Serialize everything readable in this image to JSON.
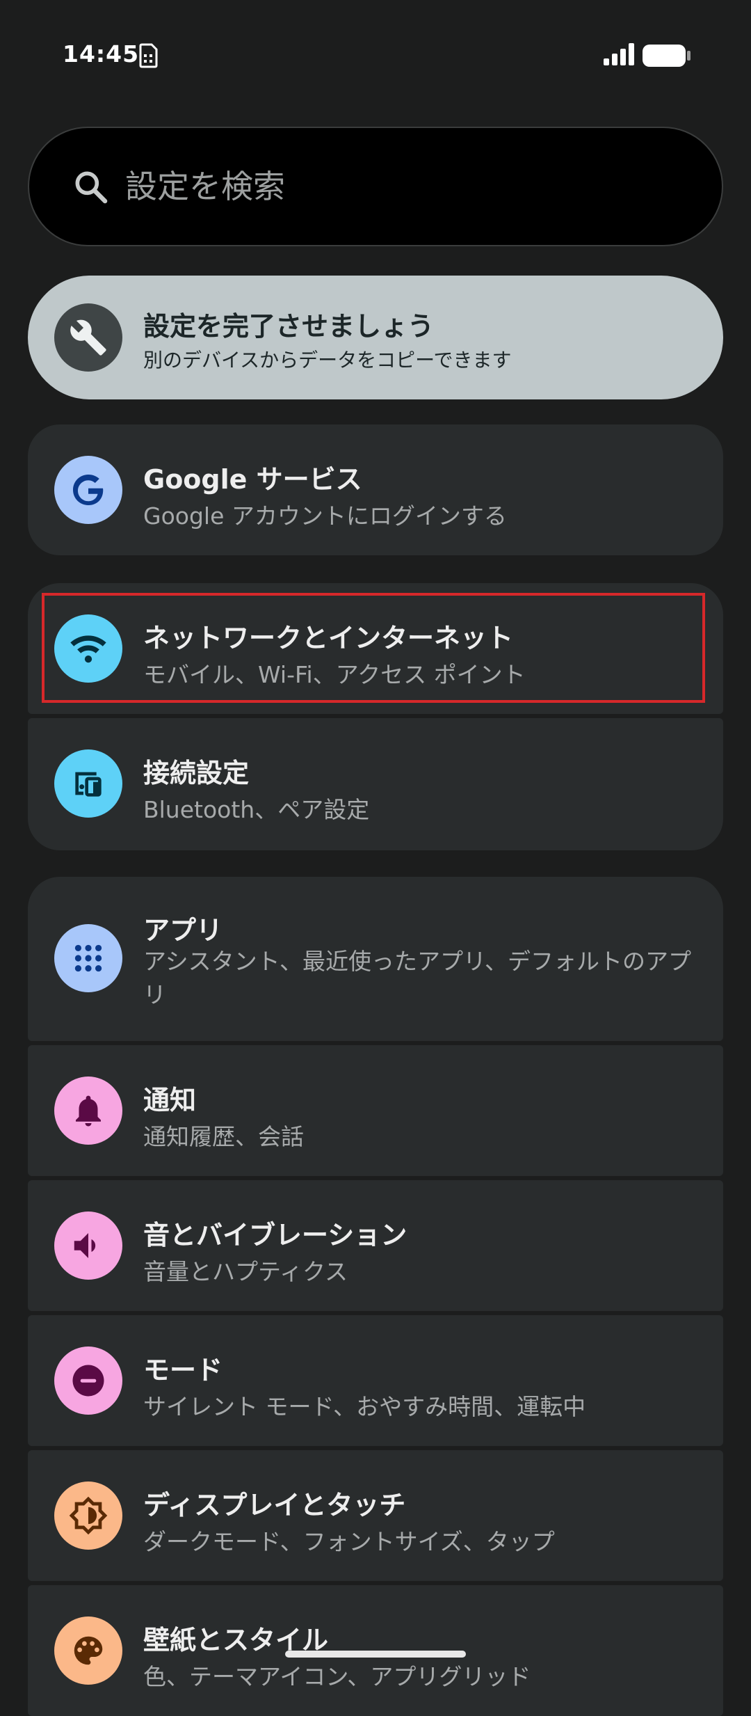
{
  "status": {
    "time": "14:45",
    "icons": [
      "sim-card-icon",
      "signal-icon",
      "battery-icon"
    ]
  },
  "search": {
    "placeholder": "設定を検索",
    "icon": "search-icon"
  },
  "setup": {
    "title": "設定を完了させましょう",
    "subtitle": "別のデバイスからデータをコピーできます",
    "icon": "wrench-icon"
  },
  "groups": [
    {
      "items": [
        {
          "title": "Google サービス",
          "subtitle": "Google アカウントにログインする",
          "icon": "google-icon",
          "color": "#a8c7fa"
        }
      ]
    },
    {
      "items": [
        {
          "title": "ネットワークとインターネット",
          "subtitle": "モバイル、Wi-Fi、アクセス ポイント",
          "icon": "wifi-icon",
          "color": "#5ed1f7"
        },
        {
          "title": "接続設定",
          "subtitle": "Bluetooth、ペア設定",
          "icon": "connected-devices-icon",
          "color": "#5ed1f7"
        }
      ]
    },
    {
      "items": [
        {
          "title": "アプリ",
          "subtitle": "アシスタント、最近使ったアプリ、デフォルトのアプリ",
          "icon": "apps-grid-icon",
          "color": "#a8c7fa"
        },
        {
          "title": "通知",
          "subtitle": "通知履歴、会話",
          "icon": "bell-icon",
          "color": "#f7a6e1"
        },
        {
          "title": "音とバイブレーション",
          "subtitle": "音量とハプティクス",
          "icon": "speaker-icon",
          "color": "#f7a6e1"
        },
        {
          "title": "モード",
          "subtitle": "サイレント モード、おやすみ時間、運転中",
          "icon": "do-not-disturb-icon",
          "color": "#f7a6e1"
        },
        {
          "title": "ディスプレイとタッチ",
          "subtitle": "ダークモード、フォントサイズ、タップ",
          "icon": "brightness-icon",
          "color": "#fbb889"
        },
        {
          "title": "壁紙とスタイル",
          "subtitle": "色、テーマアイコン、アプリグリッド",
          "icon": "palette-icon",
          "color": "#fbb889"
        }
      ]
    }
  ],
  "colors": {
    "background": "#1c1d1d",
    "card": "#292c2d",
    "setup_card": "#bfc8ca",
    "highlight": "#d6282a"
  }
}
